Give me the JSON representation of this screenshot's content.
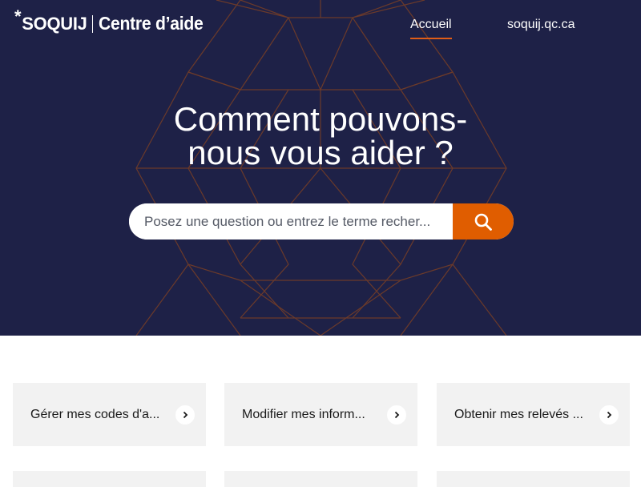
{
  "header": {
    "logo_star": "*",
    "logo_brand": "SOQUIJ",
    "logo_subtitle": "Centre d’aide",
    "nav": [
      {
        "label": "Accueil",
        "active": true
      },
      {
        "label": "soquij.qc.ca",
        "active": false
      }
    ]
  },
  "hero": {
    "title_line1": "Comment pouvons-",
    "title_line2": "nous vous aider ?",
    "search": {
      "placeholder": "Posez une question ou entrez le terme recher...",
      "value": ""
    }
  },
  "cards": [
    {
      "label": "Gérer mes codes d'a...",
      "icon": "chevron-right-icon"
    },
    {
      "label": "Modifier mes inform...",
      "icon": "chevron-right-icon"
    },
    {
      "label": "Obtenir mes relevés ...",
      "icon": "chevron-right-icon"
    }
  ],
  "colors": {
    "hero_background": "#1e2147",
    "accent": "#e05d00",
    "pattern_lines": "#6b3a2a",
    "card_background": "#f2f2f2"
  }
}
